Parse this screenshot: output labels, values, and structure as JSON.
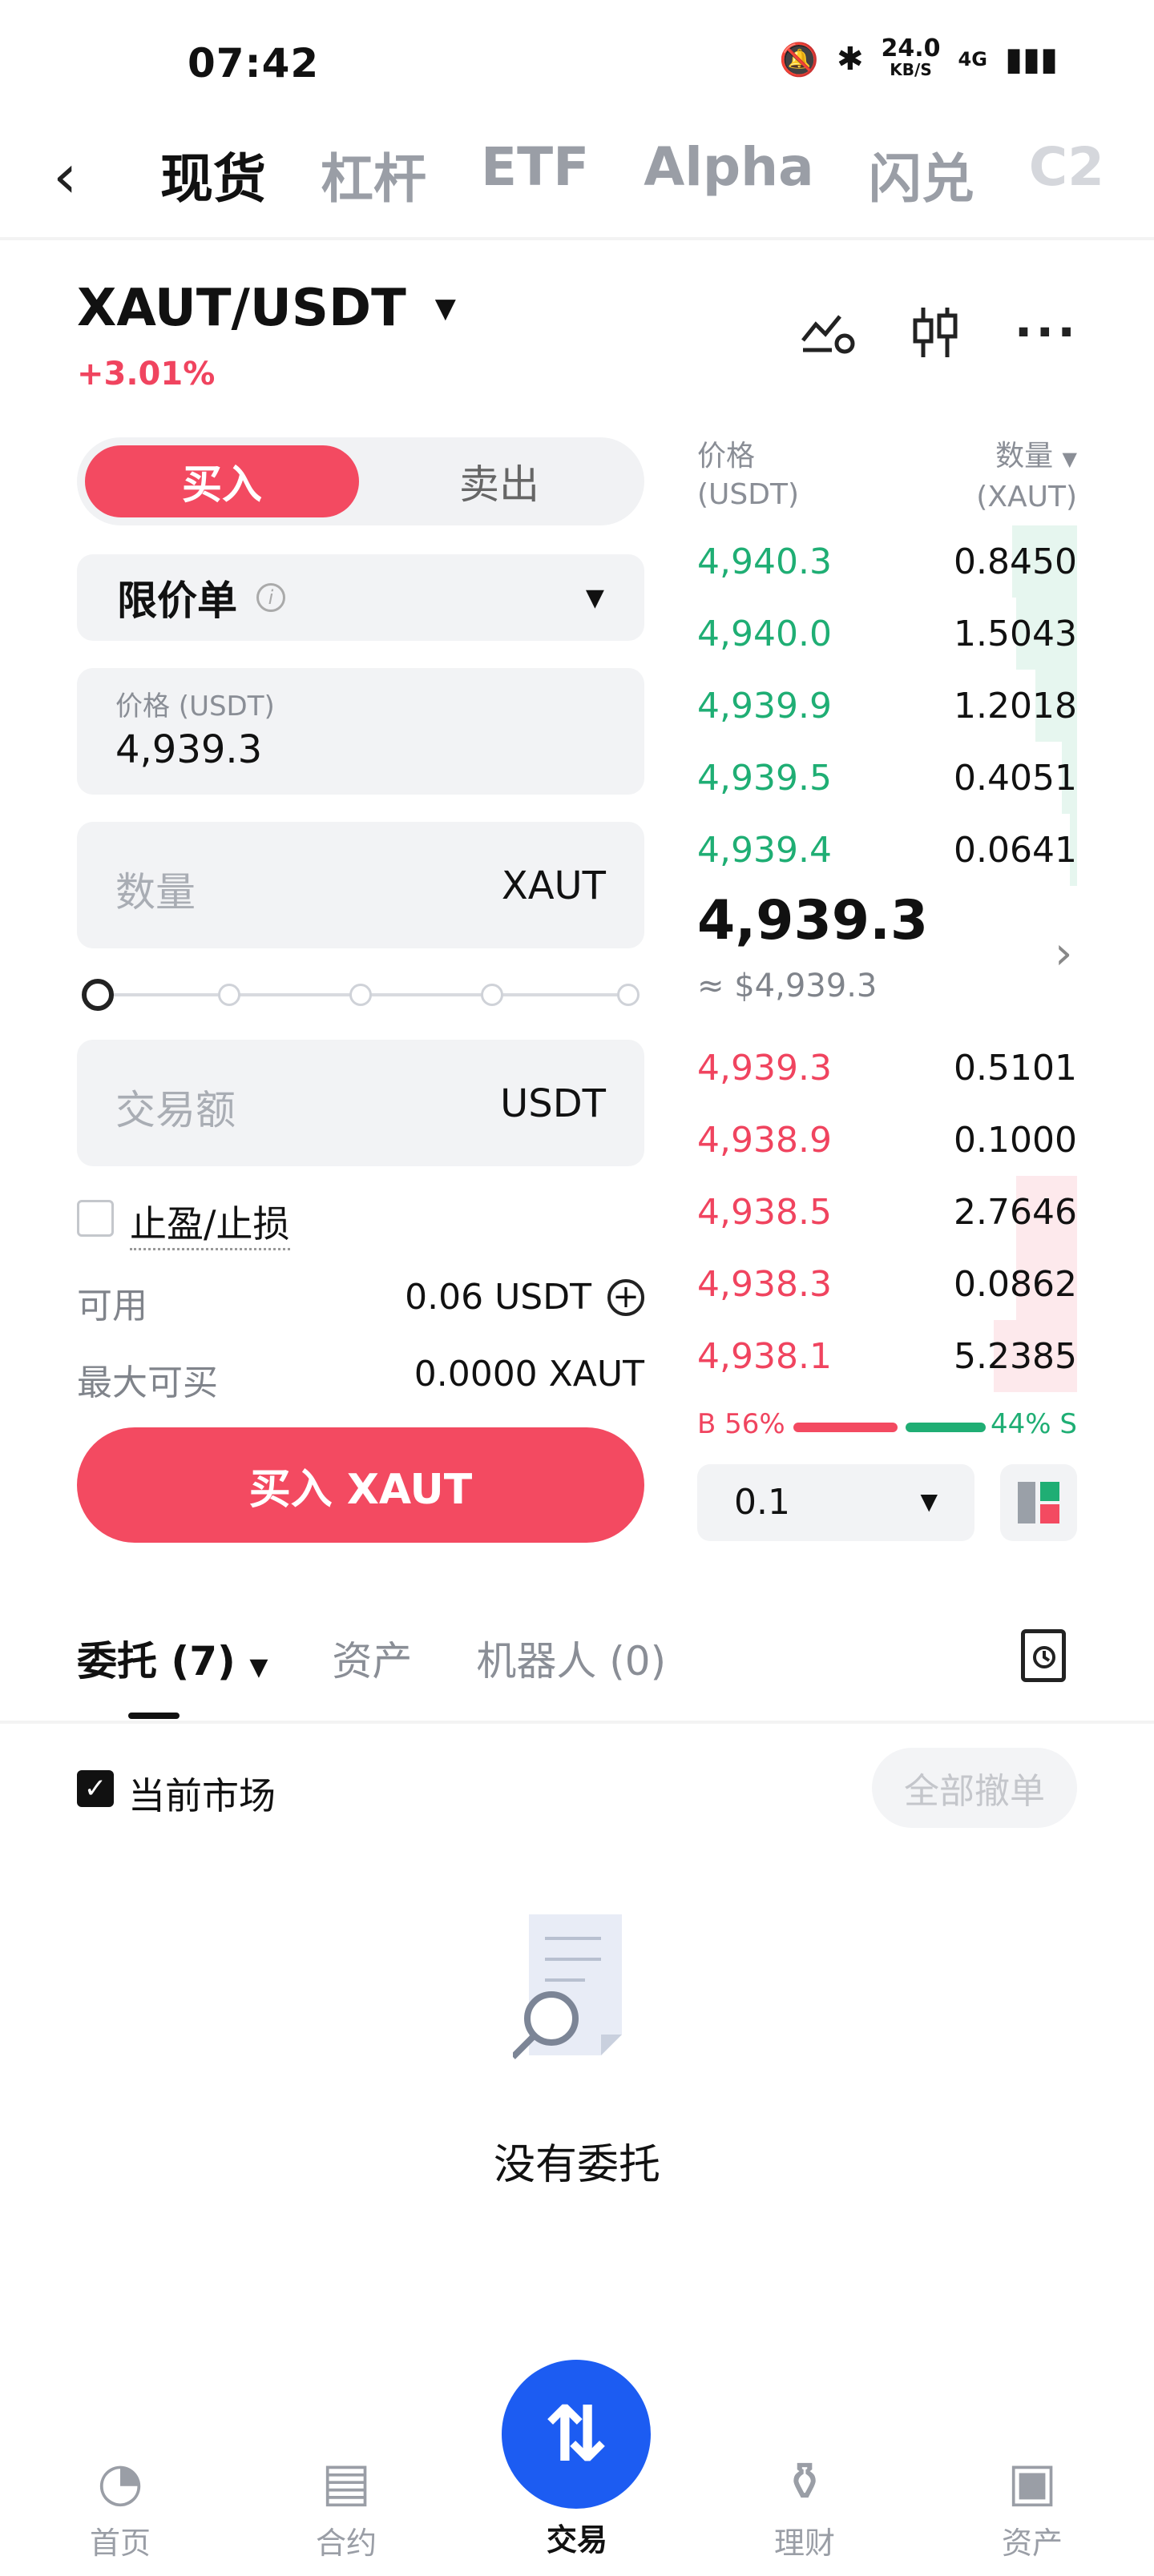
{
  "status_bar": {
    "time": "07:42",
    "net_speed": "24.0",
    "net_unit": "KB/S",
    "network": "4G"
  },
  "top_nav": {
    "tabs": [
      "现货",
      "杠杆",
      "ETF",
      "Alpha",
      "闪兑",
      "C2"
    ]
  },
  "pair": {
    "name": "XAUT/USDT",
    "change": "+3.01%"
  },
  "order_form": {
    "buy_label": "买入",
    "sell_label": "卖出",
    "order_type": "限价单",
    "price_label": "价格 (USDT)",
    "price_value": "4,939.3",
    "qty_placeholder": "数量",
    "qty_unit": "XAUT",
    "amount_placeholder": "交易额",
    "amount_unit": "USDT",
    "tpsl_label": "止盈/止损",
    "available_label": "可用",
    "available_value": "0.06 USDT",
    "max_buy_label": "最大可买",
    "max_buy_value": "0.0000 XAUT",
    "submit_label": "买入 XAUT"
  },
  "order_book": {
    "price_header": "价格",
    "price_header_unit": "(USDT)",
    "qty_header": "数量",
    "qty_header_unit": "(XAUT)",
    "asks": [
      {
        "price": "4,940.3",
        "qty": "0.8450",
        "depth": 0.17
      },
      {
        "price": "4,940.0",
        "qty": "1.5043",
        "depth": 0.16
      },
      {
        "price": "4,939.9",
        "qty": "1.2018",
        "depth": 0.11
      },
      {
        "price": "4,939.5",
        "qty": "0.4051",
        "depth": 0.04
      },
      {
        "price": "4,939.4",
        "qty": "0.0641",
        "depth": 0.02
      }
    ],
    "mid_price": "4,939.3",
    "mid_fiat": "≈ $4,939.3",
    "bids": [
      {
        "price": "4,939.3",
        "qty": "0.5101",
        "depth": 0.0
      },
      {
        "price": "4,938.9",
        "qty": "0.1000",
        "depth": 0.0
      },
      {
        "price": "4,938.5",
        "qty": "2.7646",
        "depth": 0.16
      },
      {
        "price": "4,938.3",
        "qty": "0.0862",
        "depth": 0.16
      },
      {
        "price": "4,938.1",
        "qty": "5.2385",
        "depth": 0.22
      }
    ],
    "buy_ratio": "B 56%",
    "sell_ratio": "44% S",
    "depth_step": "0.1"
  },
  "orders": {
    "tabs": [
      "委托 (7)",
      "资产",
      "机器人 (0)"
    ],
    "current_market_label": "当前市场",
    "cancel_all_label": "全部撤单",
    "empty_text": "没有委托"
  },
  "bottom_nav": [
    "首页",
    "合约",
    "交易",
    "理财",
    "资产"
  ],
  "colors": {
    "buy": "#f34a61",
    "sell": "#1fae74",
    "accent": "#1c5cf2"
  }
}
